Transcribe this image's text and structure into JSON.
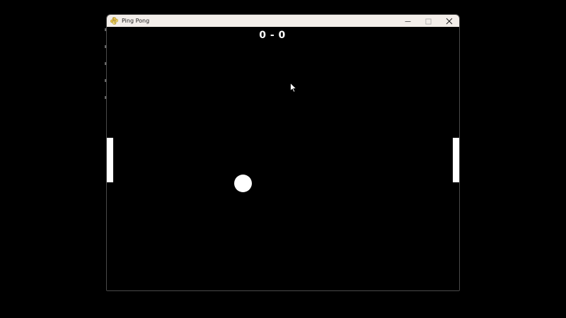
{
  "window": {
    "title": "Ping Pong",
    "app_icon": "python-icon",
    "controls": {
      "minimize": "minimize-icon",
      "maximize": "maximize-icon",
      "close": "close-icon"
    }
  },
  "game": {
    "score_text": "0 - 0",
    "colors": {
      "background": "#000000",
      "foreground": "#ffffff"
    }
  }
}
